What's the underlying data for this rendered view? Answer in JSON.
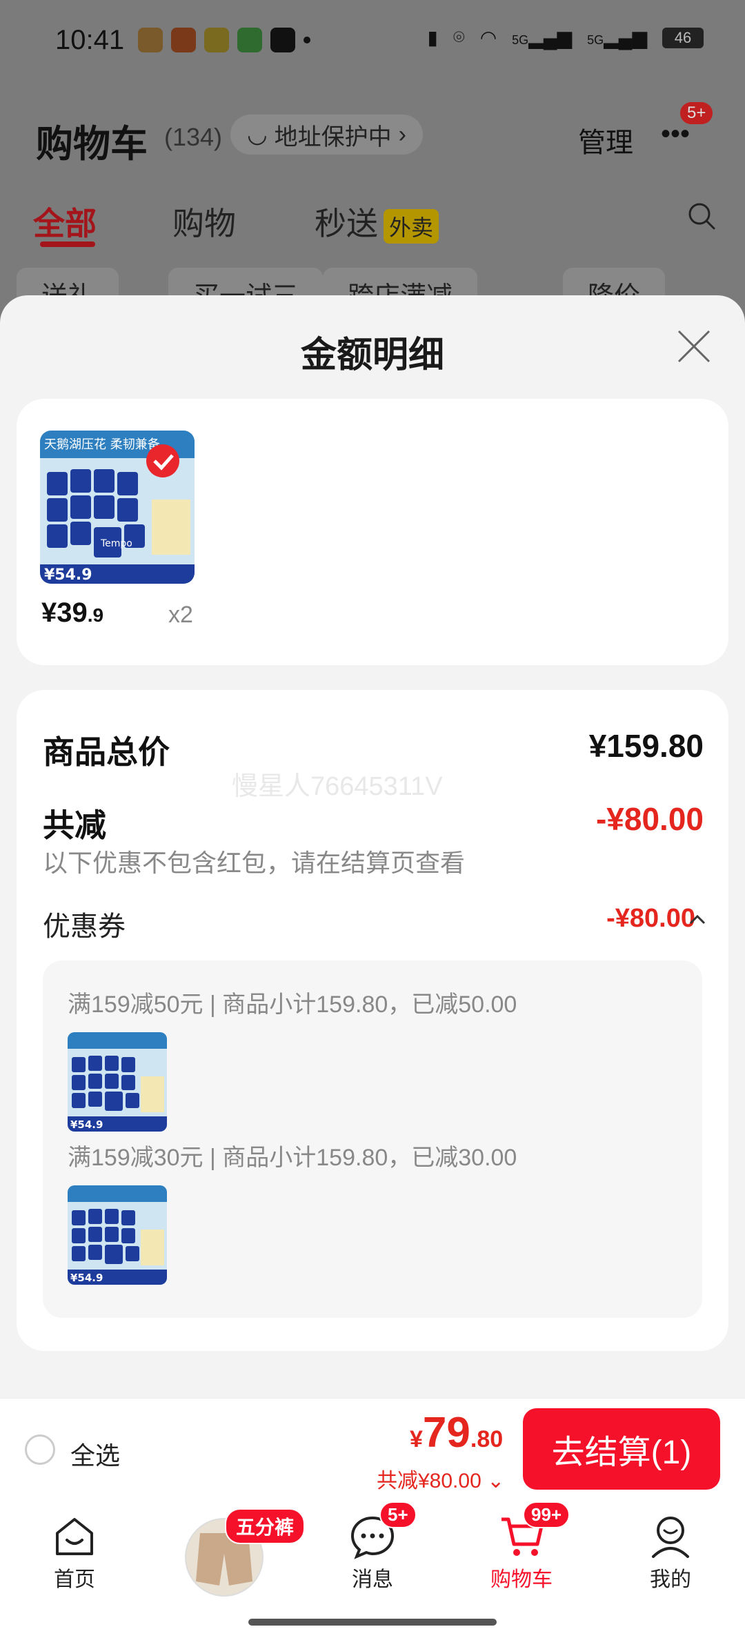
{
  "status_bar": {
    "time": "10:41",
    "icons": [
      "app-icon-orange",
      "taobao-icon",
      "app-icon-yellow",
      "wechat-icon",
      "capcut-icon",
      "dot"
    ],
    "right_icons": [
      "vibrate-icon",
      "location-icon",
      "wifi-icon",
      "signal-5g-icon",
      "signal-5g-icon"
    ],
    "signal_label": "5G",
    "battery": "46"
  },
  "cart_header": {
    "title": "购物车",
    "count": "(134)",
    "address": "地址保护中",
    "manage": "管理",
    "more_badge": "5+"
  },
  "tabs": [
    {
      "label": "全部",
      "active": true
    },
    {
      "label": "购物",
      "active": false
    },
    {
      "label": "秒送",
      "active": false,
      "tag": "外卖"
    }
  ],
  "chips": [
    "送礼",
    "买一试三",
    "跨店满减",
    "降价"
  ],
  "sheet": {
    "title": "金额明细"
  },
  "product": {
    "thumb_title": "天鹅湖压花 柔韧兼备",
    "brand": "Tempo",
    "thumb_price": "¥54.9",
    "price_int": "¥39",
    "price_dec": ".9",
    "qty": "x2"
  },
  "summary": {
    "total_label": "商品总价",
    "total_value": "¥159.80",
    "watermark": "慢星人76645311V",
    "discount_label": "共减",
    "discount_value": "-¥80.00",
    "hint": "以下优惠不包含红包，请在结算页查看",
    "coupon_label": "优惠券",
    "coupon_value": "-¥80.00"
  },
  "coupons": [
    {
      "text": "满159减50元 | 商品小计159.80，已减50.00",
      "thumb_price": "¥54.9"
    },
    {
      "text": "满159减30元 | 商品小计159.80，已减30.00",
      "thumb_price": "¥54.9"
    }
  ],
  "bottom_bar": {
    "select_all": "全选",
    "yen": "¥",
    "total_int": "79",
    "total_dec": ".80",
    "discount": "共减¥80.00",
    "checkout": "去结算(1)"
  },
  "nav": {
    "home": "首页",
    "promo_badge": "五分裤",
    "messages": "消息",
    "messages_badge": "5+",
    "cart": "购物车",
    "cart_badge": "99+",
    "me": "我的"
  },
  "colors": {
    "accent_red": "#f5112a",
    "price_red": "#e4261f",
    "tab_active": "#a3141b"
  }
}
